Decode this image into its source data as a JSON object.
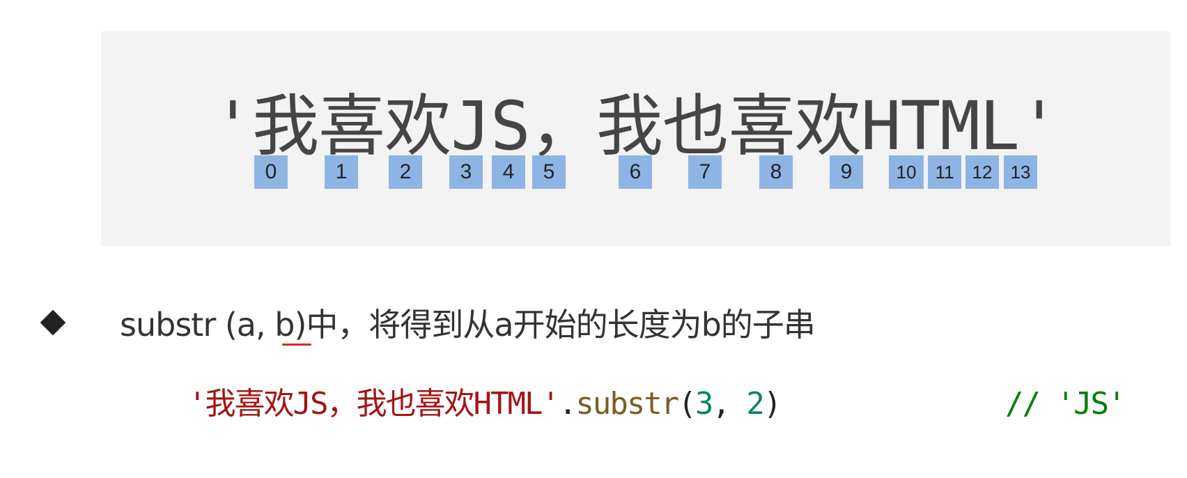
{
  "demo": {
    "string_display": "'我喜欢JS，我也喜欢HTML'",
    "indices": [
      "0",
      "1",
      "2",
      "3",
      "4",
      "5",
      "6",
      "7",
      "8",
      "9",
      "10",
      "11",
      "12",
      "13"
    ],
    "index_color": "#8eb4e3",
    "box_background": "#f3f3f4"
  },
  "bullet": {
    "icon": "diamond-bullet-icon",
    "prefix": "substr (a, ",
    "param_b": "b",
    "suffix": ")中，将得到从a开始的长度为b的子串"
  },
  "code": {
    "string_literal": "'我喜欢JS，我也喜欢HTML'",
    "dot": ".",
    "method": "substr",
    "open_paren": "(",
    "arg1": "3",
    "comma": ", ",
    "arg2": "2",
    "close_paren": ")",
    "comment": "// 'JS'"
  }
}
